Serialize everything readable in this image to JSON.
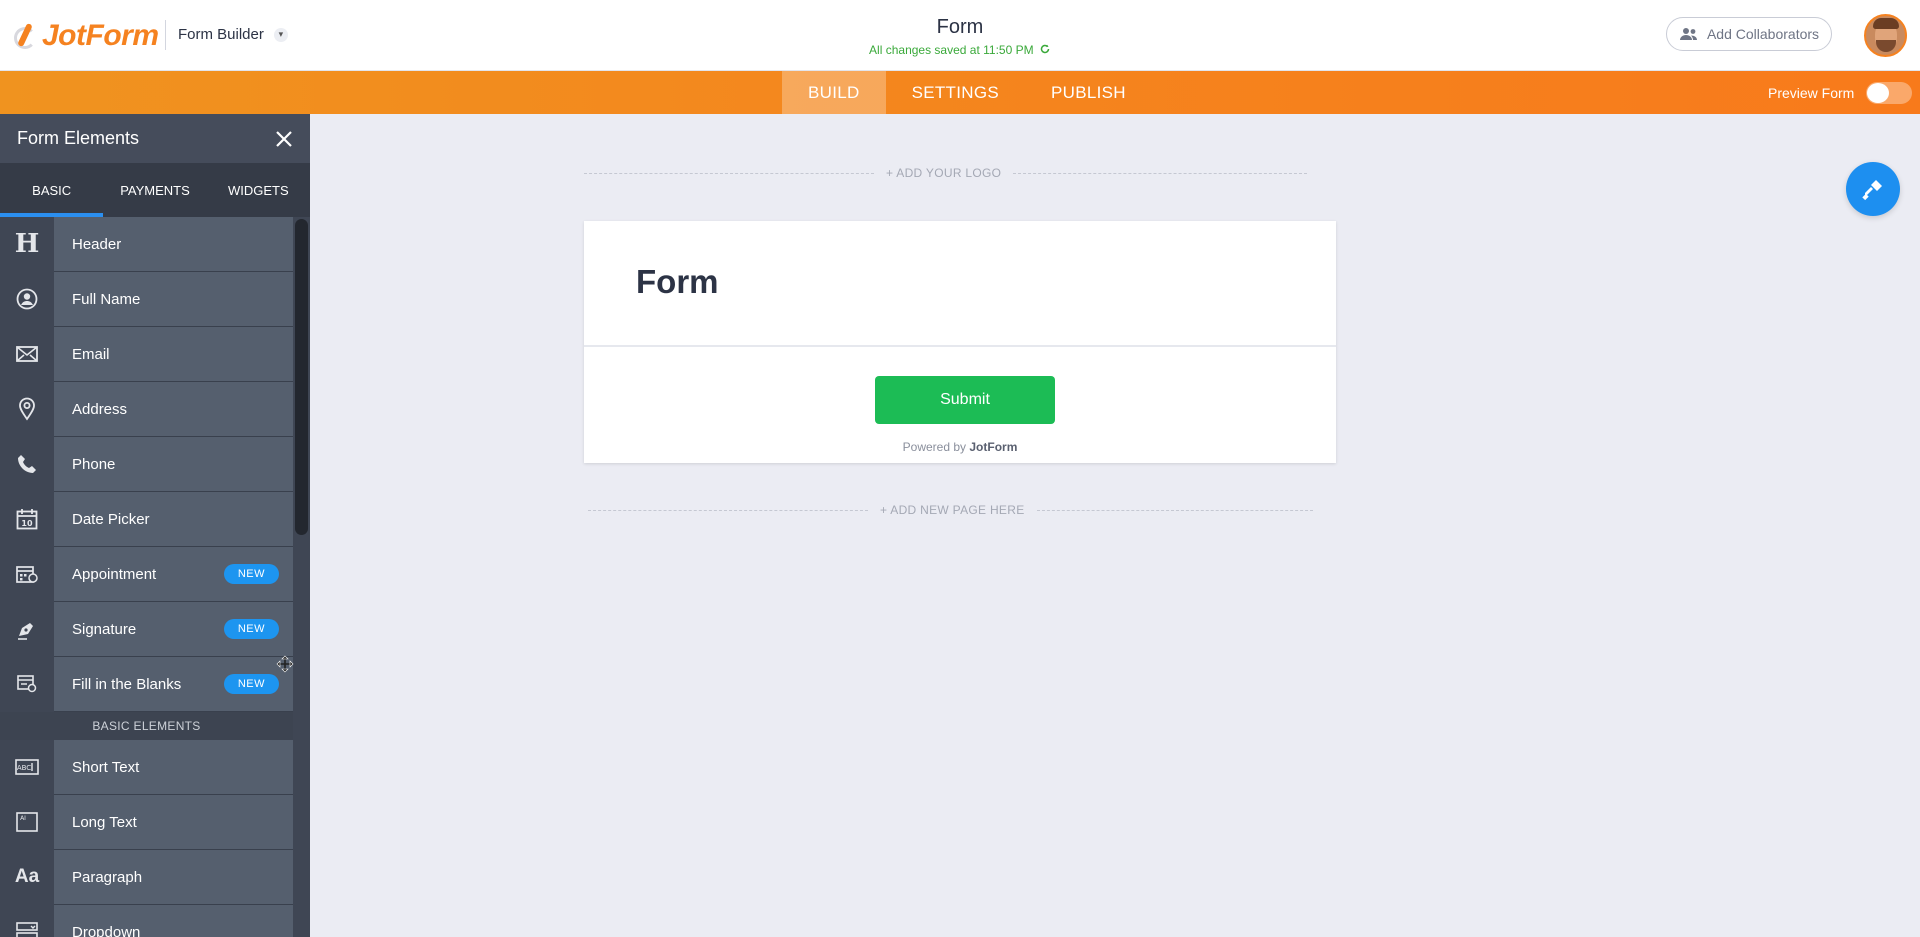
{
  "header": {
    "logo_text": "JotForm",
    "builder_switch": "Form Builder",
    "form_title": "Form",
    "saved_status": "All changes saved at 11:50 PM",
    "add_collaborators": "Add Collaborators"
  },
  "nav": {
    "tabs": [
      "BUILD",
      "SETTINGS",
      "PUBLISH"
    ],
    "active_tab": "BUILD",
    "preview_label": "Preview Form",
    "preview_on": false
  },
  "sidebar": {
    "title": "Form Elements",
    "tabs": [
      "BASIC",
      "PAYMENTS",
      "WIDGETS"
    ],
    "active_tab": "BASIC",
    "items": [
      {
        "label": "Header",
        "icon": "header-icon"
      },
      {
        "label": "Full Name",
        "icon": "user-icon"
      },
      {
        "label": "Email",
        "icon": "envelope-icon"
      },
      {
        "label": "Address",
        "icon": "map-pin-icon"
      },
      {
        "label": "Phone",
        "icon": "phone-icon"
      },
      {
        "label": "Date Picker",
        "icon": "calendar-icon"
      },
      {
        "label": "Appointment",
        "icon": "appointment-icon",
        "badge": "NEW"
      },
      {
        "label": "Signature",
        "icon": "signature-pen-icon",
        "badge": "NEW"
      },
      {
        "label": "Fill in the Blanks",
        "icon": "fill-blanks-icon",
        "badge": "NEW"
      }
    ],
    "section_label": "BASIC ELEMENTS",
    "basic_items": [
      {
        "label": "Short Text",
        "icon": "short-text-icon"
      },
      {
        "label": "Long Text",
        "icon": "long-text-icon"
      },
      {
        "label": "Paragraph",
        "icon": "paragraph-icon"
      },
      {
        "label": "Dropdown",
        "icon": "dropdown-icon"
      }
    ]
  },
  "canvas": {
    "add_logo": "+ ADD YOUR LOGO",
    "form_heading": "Form",
    "submit_label": "Submit",
    "powered_prefix": "Powered by",
    "powered_brand": "JotForm",
    "add_page": "+ ADD NEW PAGE HERE"
  },
  "colors": {
    "brand_orange": "#f58220",
    "submit_green": "#1cbc55",
    "accent_blue": "#1d8ff0",
    "saved_green": "#3aa93a"
  }
}
